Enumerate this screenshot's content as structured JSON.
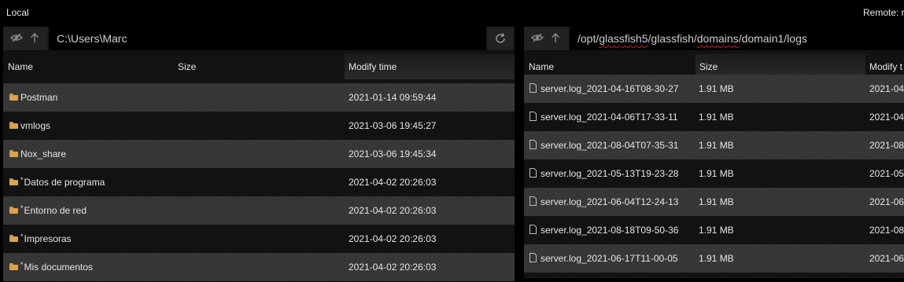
{
  "local": {
    "label": "Local",
    "path": "C:\\Users\\Marc",
    "columns": {
      "name": "Name",
      "size": "Size",
      "modified": "Modify time"
    },
    "files": [
      {
        "name": "Postman",
        "size": "",
        "modified": "2021-01-14 09:59:44",
        "shortcut": false
      },
      {
        "name": "vmlogs",
        "size": "",
        "modified": "2021-03-06 19:45:27",
        "shortcut": false
      },
      {
        "name": "Nox_share",
        "size": "",
        "modified": "2021-03-06 19:45:34",
        "shortcut": false
      },
      {
        "name": "Datos de programa",
        "size": "",
        "modified": "2021-04-02 20:26:03",
        "shortcut": true
      },
      {
        "name": "Entorno de red",
        "size": "",
        "modified": "2021-04-02 20:26:03",
        "shortcut": true
      },
      {
        "name": "Impresoras",
        "size": "",
        "modified": "2021-04-02 20:26:03",
        "shortcut": true
      },
      {
        "name": "Mis documentos",
        "size": "",
        "modified": "2021-04-02 20:26:03",
        "shortcut": true
      }
    ]
  },
  "remote": {
    "label": "Remote: r",
    "path_prefix": "/opt/",
    "path_highlight": "glassfish5",
    "path_middle": "/glassfish/",
    "path_highlight2": "domains",
    "path_suffix": "/domain1/logs",
    "columns": {
      "name": "Name",
      "size": "Size",
      "modified": "Modify t"
    },
    "files": [
      {
        "name": "server.log_2021-04-16T08-30-27",
        "size": "1.91 MB",
        "modified": "2021-04"
      },
      {
        "name": "server.log_2021-04-06T17-33-11",
        "size": "1.91 MB",
        "modified": "2021-04"
      },
      {
        "name": "server.log_2021-08-04T07-35-31",
        "size": "1.91 MB",
        "modified": "2021-08"
      },
      {
        "name": "server.log_2021-05-13T19-23-28",
        "size": "1.91 MB",
        "modified": "2021-05"
      },
      {
        "name": "server.log_2021-06-04T12-24-13",
        "size": "1.91 MB",
        "modified": "2021-06"
      },
      {
        "name": "server.log_2021-08-18T09-50-36",
        "size": "1.91 MB",
        "modified": "2021-08"
      },
      {
        "name": "server.log_2021-06-17T11-00-05",
        "size": "1.91 MB",
        "modified": "2021-06"
      }
    ]
  },
  "icons": {
    "hidden_toggle": "eye-slash-icon",
    "up": "arrow-up-icon",
    "refresh": "refresh-icon",
    "folder": "folder-icon",
    "file": "file-icon"
  },
  "colors": {
    "folder": "#d9a34c",
    "spellcheck": "#d21a1a",
    "row_alt": "#353535"
  }
}
